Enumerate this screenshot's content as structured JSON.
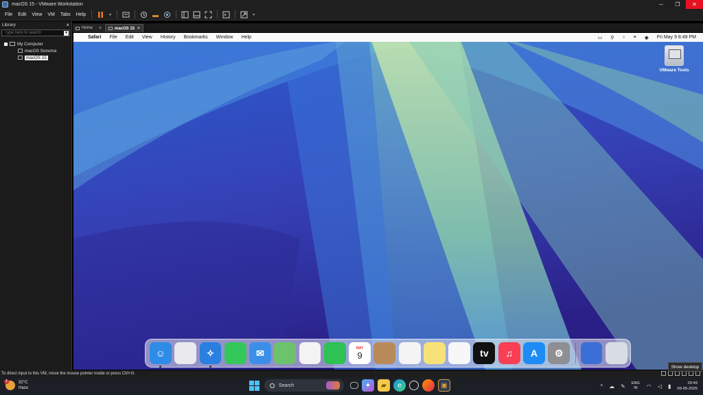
{
  "window": {
    "title": "macOS 15 - VMware Workstation",
    "close_color": "#e81123"
  },
  "vmware_menu": [
    "File",
    "Edit",
    "View",
    "VM",
    "Tabs",
    "Help"
  ],
  "toolbar": {
    "pause_color": "#e8792b",
    "icons": [
      "pause-icon",
      "send-keys-icon",
      "snapshot-icon",
      "revert-snapshot-icon",
      "snapshot-manager-icon",
      "library-view-icon",
      "thumbnail-view-icon",
      "fullscreen-icon",
      "console-icon",
      "stretch-icon"
    ]
  },
  "library": {
    "title": "Library",
    "close": "×",
    "search_placeholder": "Type here to search",
    "tree": {
      "root": "My Computer",
      "vms": [
        "macOS Sonoma",
        "macOS 15"
      ],
      "selected": "macOS 15"
    }
  },
  "tabs": [
    {
      "label": "Home"
    },
    {
      "label": "macOS 15",
      "active": true
    }
  ],
  "mac": {
    "apple": "",
    "menus": [
      "Safari",
      "File",
      "Edit",
      "View",
      "History",
      "Bookmarks",
      "Window",
      "Help"
    ],
    "clock": "Fri May 9  8:49 PM",
    "desktop_icon": "VMware Tools",
    "dock": [
      {
        "name": "finder",
        "color": "#2f8ce6",
        "glyph": "☺",
        "running": true
      },
      {
        "name": "launchpad",
        "color": "#e9e9ee",
        "glyph": ""
      },
      {
        "name": "safari",
        "color": "#2a7fe0",
        "glyph": "✧",
        "running": true
      },
      {
        "name": "messages",
        "color": "#34c759",
        "glyph": ""
      },
      {
        "name": "mail",
        "color": "#3b8fe8",
        "glyph": "✉"
      },
      {
        "name": "maps",
        "color": "#6cc36c",
        "glyph": ""
      },
      {
        "name": "photos",
        "color": "#f3f3f3",
        "glyph": ""
      },
      {
        "name": "facetime",
        "color": "#2ec154",
        "glyph": ""
      },
      {
        "name": "calendar",
        "color": "#ffffff",
        "glyph": "9",
        "month": "MAY"
      },
      {
        "name": "contacts",
        "color": "#b88a5a",
        "glyph": ""
      },
      {
        "name": "reminders",
        "color": "#f4f4f4",
        "glyph": ""
      },
      {
        "name": "notes",
        "color": "#f7e27a",
        "glyph": ""
      },
      {
        "name": "freeform",
        "color": "#f7f7f7",
        "glyph": ""
      },
      {
        "name": "apple-tv",
        "color": "#111111",
        "glyph": "tv"
      },
      {
        "name": "music",
        "color": "#fa3f55",
        "glyph": "♫"
      },
      {
        "name": "app-store",
        "color": "#1d8cf5",
        "glyph": "A"
      },
      {
        "name": "system-settings",
        "color": "#8e8e93",
        "glyph": "⚙"
      },
      {
        "name": "downloads-stack",
        "color": "#3a6fd6",
        "glyph": ""
      },
      {
        "name": "trash",
        "color": "#d8dde3",
        "glyph": ""
      }
    ]
  },
  "statusbar": {
    "message": "To direct input to this VM, move the mouse pointer inside or press Ctrl+G."
  },
  "tooltip": "Show desktop",
  "taskbar": {
    "weather_temp": "32°C",
    "weather_desc": "Haze",
    "weather_badge": "1",
    "search_label": "Search",
    "lang_top": "ENG",
    "lang_bottom": "IN",
    "time": "20:49",
    "date": "09-05-2025"
  }
}
